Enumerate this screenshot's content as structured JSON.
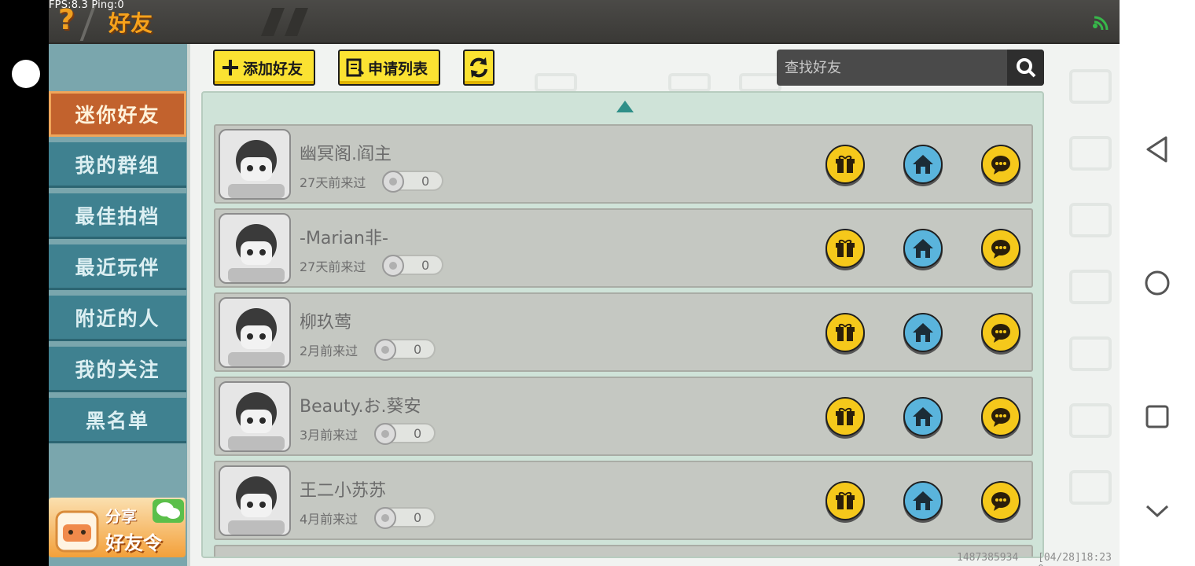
{
  "status": {
    "fps": "FPS:8.3  Ping:0"
  },
  "header": {
    "title": "好友"
  },
  "sidebar": {
    "items": [
      {
        "label": "迷你好友",
        "active": true
      },
      {
        "label": "我的群组"
      },
      {
        "label": "最佳拍档"
      },
      {
        "label": "最近玩伴"
      },
      {
        "label": "附近的人"
      },
      {
        "label": "我的关注"
      },
      {
        "label": "黑名单"
      }
    ],
    "share": {
      "line1": "分享",
      "line2": "好友令"
    }
  },
  "toolbar": {
    "add_friend": "添加好友",
    "request_list": "申请列表"
  },
  "search": {
    "placeholder": "查找好友"
  },
  "friends": [
    {
      "name": "幽冥阁.阎主",
      "last_seen": "27天前来过",
      "score": "0"
    },
    {
      "name": "-Marian非-",
      "last_seen": "27天前来过",
      "score": "0"
    },
    {
      "name": "柳玖莺",
      "last_seen": "2月前来过",
      "score": "0"
    },
    {
      "name": "Beauty.お.葵安",
      "last_seen": "3月前来过",
      "score": "0"
    },
    {
      "name": "王二小苏苏",
      "last_seen": "4月前来过",
      "score": "0"
    }
  ],
  "footer": {
    "id": "1487385934",
    "time": "[04/28]18:23 0"
  },
  "colors": {
    "accent": "#f7a21b",
    "button_yellow": "#fbe232",
    "button_blue": "#5ab4dc",
    "sidebar": "#3f8190",
    "sidebar_active": "#c2622d"
  },
  "icons": [
    "help-icon",
    "wifi-icon",
    "add-friend-icon",
    "list-icon",
    "refresh-icon",
    "search-icon",
    "gift-icon",
    "home-icon",
    "chat-icon",
    "back-icon",
    "home-circle-icon",
    "recents-icon",
    "chevron-down-icon"
  ]
}
